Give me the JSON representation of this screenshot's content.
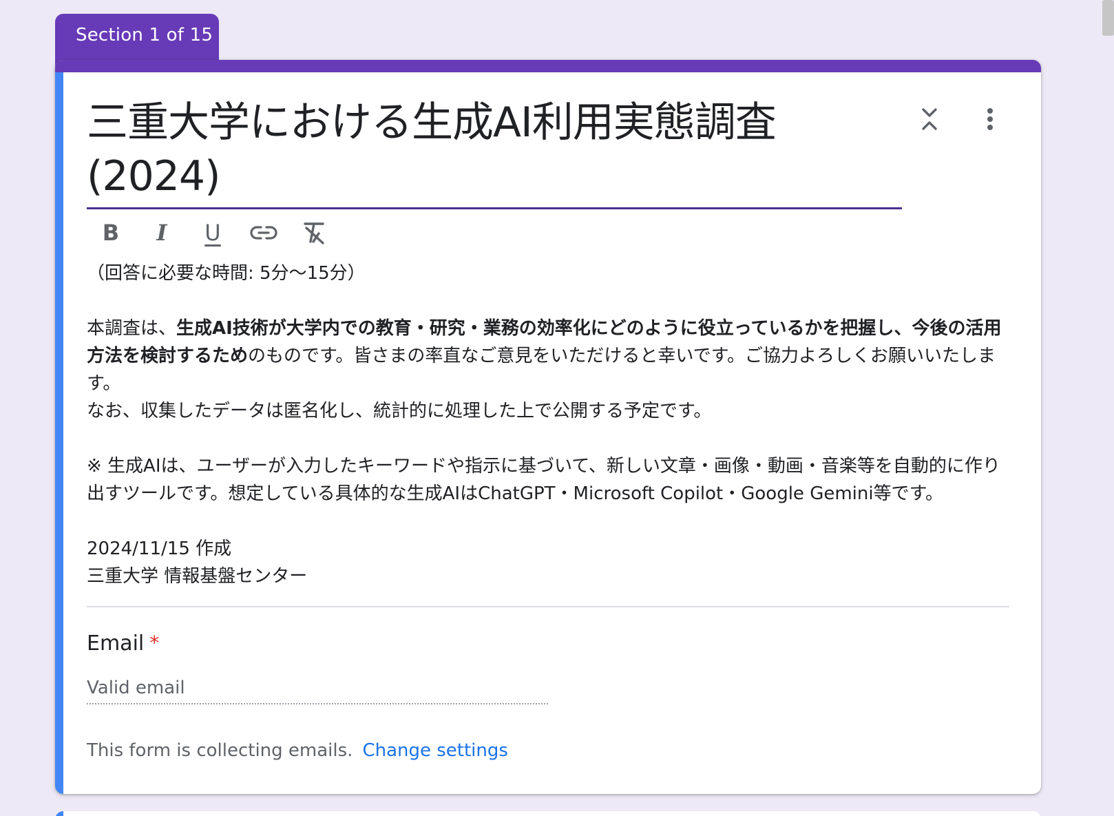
{
  "section_tab": {
    "label": "Section 1 of 15"
  },
  "form": {
    "title_line1": "三重大学における生成AI利用実態調査",
    "title_line2": "(2024)",
    "toolbar": {
      "bold": "B",
      "italic": "I",
      "underline": "U"
    },
    "description": {
      "time_note": "（回答に必要な時間: 5分〜15分）",
      "para1_prefix": "本調査は、",
      "para1_bold": "生成AI技術が大学内での教育・研究・業務の効率化にどのように役立っているかを把握し、今後の活用方法を検討するため",
      "para1_suffix": "のものです。皆さまの率直なご意見をいただけると幸いです。ご協力よろしくお願いいたします。",
      "para2": "なお、収集したデータは匿名化し、統計的に処理した上で公開する予定です。",
      "note": "※ 生成AIは、ユーザーが入力したキーワードや指示に基づいて、新しい文章・画像・動画・音楽等を自動的に作り出すツールです。想定している具体的な生成AIはChatGPT・Microsoft Copilot・Google Gemini等です。",
      "date": "2024/11/15 作成",
      "author": "三重大学 情報基盤センター"
    }
  },
  "email": {
    "label": "Email",
    "required_mark": "*",
    "placeholder": "Valid email",
    "collect_note": "This form is collecting emails.",
    "change_link": "Change settings"
  },
  "colors": {
    "theme": "#673ab7",
    "accent_bar": "#4285f4",
    "link": "#1a73e8",
    "required": "#d93025",
    "background": "#ede9f6"
  },
  "icons": {
    "collapse": "collapse-icon",
    "more": "more-vert-icon",
    "link": "link-icon",
    "clear_format": "clear-format-icon"
  }
}
